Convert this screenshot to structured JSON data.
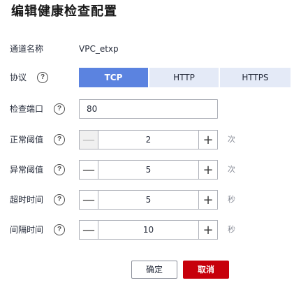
{
  "dialog": {
    "title": "编辑健康检查配置"
  },
  "fields": {
    "channel_name": {
      "label": "通道名称",
      "value": "VPC_etxp"
    },
    "protocol": {
      "label": "协议",
      "options": [
        "TCP",
        "HTTP",
        "HTTPS"
      ],
      "selected": "TCP"
    },
    "check_port": {
      "label": "检查端口",
      "value": "80"
    },
    "healthy_threshold": {
      "label": "正常阈值",
      "value": "2",
      "unit": "次",
      "minus_disabled": true
    },
    "unhealthy_threshold": {
      "label": "异常阈值",
      "value": "5",
      "unit": "次"
    },
    "timeout": {
      "label": "超时时间",
      "value": "5",
      "unit": "秒"
    },
    "interval": {
      "label": "间隔时间",
      "value": "10",
      "unit": "秒"
    }
  },
  "icons": {
    "help": "?",
    "minus": "—",
    "plus": "+"
  },
  "buttons": {
    "ok": "确定",
    "cancel": "取消"
  },
  "colors": {
    "accent": "#5b83e0",
    "segment_bg": "#e4eaf7",
    "danger": "#c7000b"
  }
}
